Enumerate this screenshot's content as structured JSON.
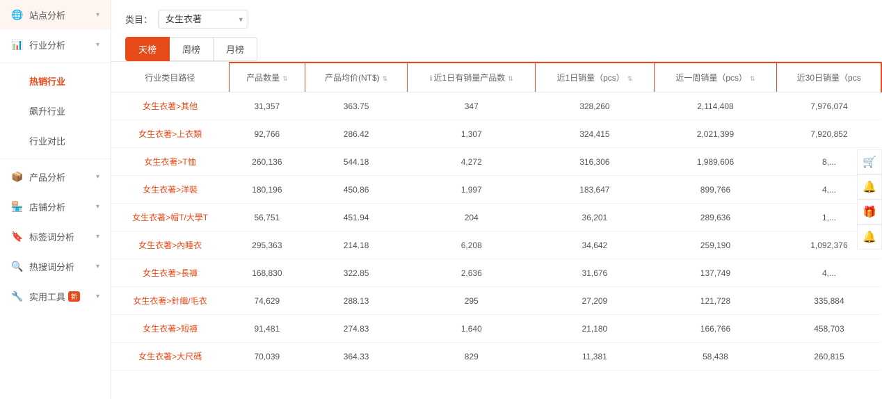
{
  "sidebar": {
    "items": [
      {
        "id": "site-analysis",
        "label": "站点分析",
        "icon": "🌐",
        "hasArrow": true,
        "active": false
      },
      {
        "id": "industry-analysis",
        "label": "行业分析",
        "icon": "📊",
        "hasArrow": true,
        "active": false
      },
      {
        "id": "hot-industry",
        "label": "热销行业",
        "icon": "",
        "hasArrow": false,
        "active": true
      },
      {
        "id": "rising-industry",
        "label": "飙升行业",
        "icon": "",
        "hasArrow": false,
        "active": false
      },
      {
        "id": "industry-compare",
        "label": "行业对比",
        "icon": "",
        "hasArrow": false,
        "active": false
      },
      {
        "id": "product-analysis",
        "label": "产品分析",
        "icon": "📦",
        "hasArrow": true,
        "active": false
      },
      {
        "id": "store-analysis",
        "label": "店铺分析",
        "icon": "🏪",
        "hasArrow": true,
        "active": false
      },
      {
        "id": "keyword-analysis",
        "label": "标签词分析",
        "icon": "🔖",
        "hasArrow": true,
        "active": false
      },
      {
        "id": "search-analysis",
        "label": "热搜词分析",
        "icon": "🔍",
        "hasArrow": true,
        "active": false
      },
      {
        "id": "tools",
        "label": "实用工具",
        "icon": "🔧",
        "hasArrow": true,
        "active": false,
        "badge": "新"
      }
    ]
  },
  "header": {
    "category_label": "类目：",
    "category_value": "女生衣著",
    "category_placeholder": "女生衣著"
  },
  "tabs": [
    {
      "id": "daily",
      "label": "天榜",
      "active": true
    },
    {
      "id": "weekly",
      "label": "周榜",
      "active": false
    },
    {
      "id": "monthly",
      "label": "月榜",
      "active": false
    }
  ],
  "table": {
    "columns": [
      {
        "id": "industry-path",
        "label": "行业类目路径",
        "highlighted": false,
        "sortable": false,
        "info": false
      },
      {
        "id": "product-count",
        "label": "产品数量",
        "highlighted": true,
        "sortable": true,
        "info": false
      },
      {
        "id": "avg-price",
        "label": "产品均价(NT$)",
        "highlighted": true,
        "sortable": true,
        "info": false
      },
      {
        "id": "sales-count-1d",
        "label": "近1日有销量产品数",
        "highlighted": true,
        "sortable": true,
        "info": true
      },
      {
        "id": "sales-1d",
        "label": "近1日销量（pcs）",
        "highlighted": true,
        "sortable": true,
        "info": false
      },
      {
        "id": "sales-1w",
        "label": "近一周销量（pcs）",
        "highlighted": true,
        "sortable": true,
        "info": false
      },
      {
        "id": "sales-30d",
        "label": "近30日销量（pcs",
        "highlighted": true,
        "sortable": false,
        "info": false
      }
    ],
    "rows": [
      {
        "path": "女生衣著>其他",
        "product_count": "31,357",
        "avg_price": "363.75",
        "sales_count_1d": "347",
        "sales_1d": "328,260",
        "sales_1w": "2,114,408",
        "sales_30d": "7,976,074"
      },
      {
        "path": "女生衣著>上衣類",
        "product_count": "92,766",
        "avg_price": "286.42",
        "sales_count_1d": "1,307",
        "sales_1d": "324,415",
        "sales_1w": "2,021,399",
        "sales_30d": "7,920,852"
      },
      {
        "path": "女生衣著>T恤",
        "product_count": "260,136",
        "avg_price": "544.18",
        "sales_count_1d": "4,272",
        "sales_1d": "316,306",
        "sales_1w": "1,989,606",
        "sales_30d": "8,..."
      },
      {
        "path": "女生衣著>洋裝",
        "product_count": "180,196",
        "avg_price": "450.86",
        "sales_count_1d": "1,997",
        "sales_1d": "183,647",
        "sales_1w": "899,766",
        "sales_30d": "4,..."
      },
      {
        "path": "女生衣著>帽T/大學T",
        "product_count": "56,751",
        "avg_price": "451.94",
        "sales_count_1d": "204",
        "sales_1d": "36,201",
        "sales_1w": "289,636",
        "sales_30d": "1,..."
      },
      {
        "path": "女生衣著>內睡衣",
        "product_count": "295,363",
        "avg_price": "214.18",
        "sales_count_1d": "6,208",
        "sales_1d": "34,642",
        "sales_1w": "259,190",
        "sales_30d": "1,092,376"
      },
      {
        "path": "女生衣著>長褲",
        "product_count": "168,830",
        "avg_price": "322.85",
        "sales_count_1d": "2,636",
        "sales_1d": "31,676",
        "sales_1w": "137,749",
        "sales_30d": "4,..."
      },
      {
        "path": "女生衣著>針織/毛衣",
        "product_count": "74,629",
        "avg_price": "288.13",
        "sales_count_1d": "295",
        "sales_1d": "27,209",
        "sales_1w": "121,728",
        "sales_30d": "335,884"
      },
      {
        "path": "女生衣著>短褲",
        "product_count": "91,481",
        "avg_price": "274.83",
        "sales_count_1d": "1,640",
        "sales_1d": "21,180",
        "sales_1w": "166,766",
        "sales_30d": "458,703"
      },
      {
        "path": "女生衣著>大尺碼",
        "product_count": "70,039",
        "avg_price": "364.33",
        "sales_count_1d": "829",
        "sales_1d": "11,381",
        "sales_1w": "58,438",
        "sales_30d": "260,815"
      }
    ]
  },
  "float_icons": [
    {
      "id": "cart-icon",
      "symbol": "🛒"
    },
    {
      "id": "bell-icon",
      "symbol": "🔔"
    },
    {
      "id": "gift-icon",
      "symbol": "🎁"
    },
    {
      "id": "bell2-icon",
      "symbol": "🔔"
    }
  ]
}
